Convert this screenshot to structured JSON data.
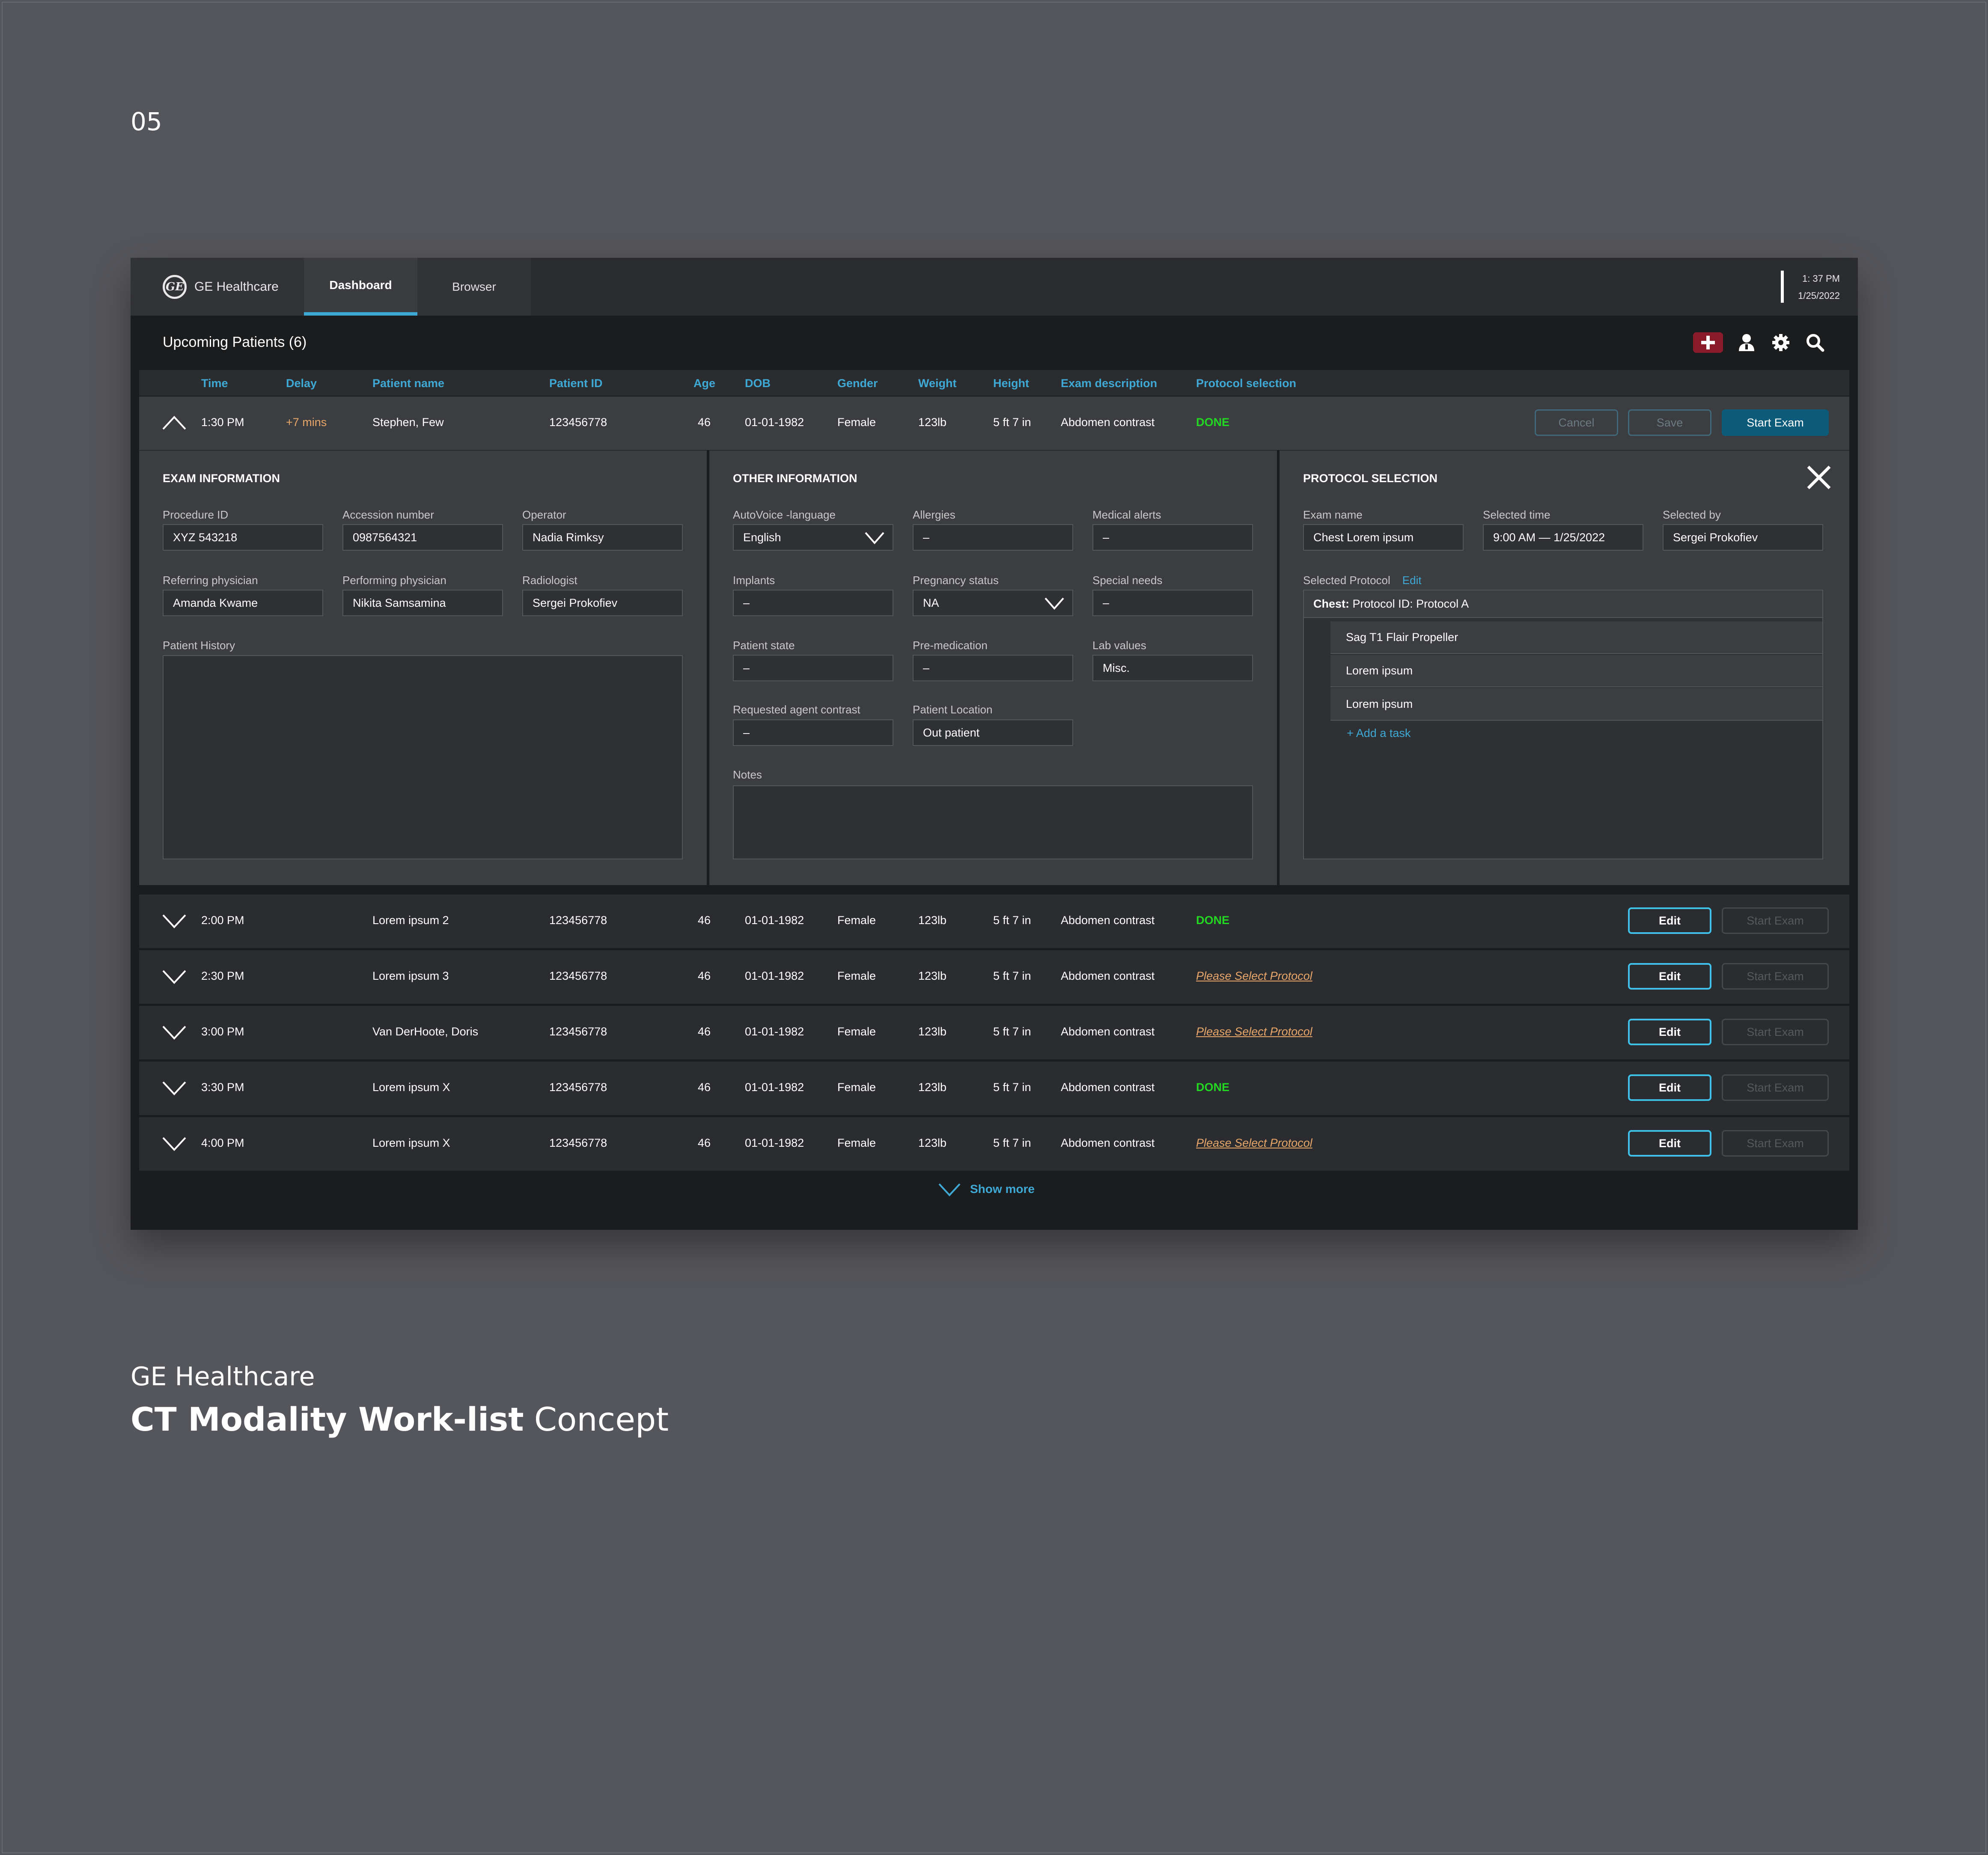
{
  "page_number": "05",
  "caption": {
    "company": "GE Healthcare",
    "title_bold": "CT Modality Work-list",
    "title_light": "Concept"
  },
  "topbar": {
    "brand": "GE Healthcare",
    "logo_text": "GE",
    "tabs": [
      "Dashboard",
      "Browser"
    ],
    "time": "1: 37 PM",
    "date": "1/25/2022"
  },
  "section_title": "Upcoming Patients (6)",
  "toolbar_icons": [
    "add-patient-icon",
    "user-icon",
    "gear-icon",
    "search-icon"
  ],
  "columns": [
    "Time",
    "Delay",
    "Patient name",
    "Patient ID",
    "Age",
    "DOB",
    "Gender",
    "Weight",
    "Height",
    "Exam description",
    "Protocol selection"
  ],
  "active_row": {
    "time": "1:30 PM",
    "delay": "+7 mins",
    "name": "Stephen, Few",
    "patient_id": "123456778",
    "age": "46",
    "dob": "01-01-1982",
    "gender": "Female",
    "weight": "123lb",
    "height": "5 ft 7 in",
    "exam": "Abdomen contrast",
    "protocol": "DONE",
    "buttons": {
      "cancel": "Cancel",
      "save": "Save",
      "start": "Start Exam"
    }
  },
  "exam_info": {
    "title": "EXAM INFORMATION",
    "procedure_id_label": "Procedure ID",
    "procedure_id": "XYZ 543218",
    "accession_label": "Accession number",
    "accession": "0987564321",
    "operator_label": "Operator",
    "operator": "Nadia Rimksy",
    "referring_label": "Referring physician",
    "referring": "Amanda Kwame",
    "performing_label": "Performing physician",
    "performing": "Nikita Samsamina",
    "radiologist_label": "Radiologist",
    "radiologist": "Sergei Prokofiev",
    "history_label": "Patient History"
  },
  "other_info": {
    "title": "OTHER INFORMATION",
    "autovoice_label": "AutoVoice -language",
    "autovoice": "English",
    "allergies_label": "Allergies",
    "allergies": "–",
    "medical_alerts_label": "Medical alerts",
    "medical_alerts": "–",
    "implants_label": "Implants",
    "implants": "–",
    "pregnancy_label": "Pregnancy status",
    "pregnancy": "NA",
    "special_needs_label": "Special needs",
    "special_needs": "–",
    "patient_state_label": "Patient state",
    "patient_state": "–",
    "premed_label": "Pre-medication",
    "premed": "–",
    "lab_label": "Lab values",
    "lab": "Misc.",
    "agent_label": "Requested agent contrast",
    "agent": "–",
    "location_label": "Patient Location",
    "location": "Out patient",
    "notes_label": "Notes"
  },
  "protocol": {
    "title": "PROTOCOL SELECTION",
    "exam_name_label": "Exam name",
    "exam_name": "Chest Lorem ipsum",
    "selected_time_label": "Selected time",
    "selected_time": "9:00 AM — 1/25/2022",
    "selected_by_label": "Selected by",
    "selected_by": "Sergei Prokofiev",
    "selected_protocol_label": "Selected Protocol",
    "edit": "Edit",
    "header_bold": "Chest:",
    "header_rest": " Protocol ID: Protocol A",
    "items": [
      "Sag T1 Flair Propeller",
      "Lorem ipsum",
      "Lorem ipsum"
    ],
    "add_task": "+ Add a task"
  },
  "rows": [
    {
      "time": "2:00 PM",
      "name": "Lorem ipsum 2",
      "patient_id": "123456778",
      "age": "46",
      "dob": "01-01-1982",
      "gender": "Female",
      "weight": "123lb",
      "height": "5 ft 7 in",
      "exam": "Abdomen contrast",
      "protocol": "DONE",
      "edit": "Edit",
      "start": "Start Exam"
    },
    {
      "time": "2:30 PM",
      "name": "Lorem ipsum 3",
      "patient_id": "123456778",
      "age": "46",
      "dob": "01-01-1982",
      "gender": "Female",
      "weight": "123lb",
      "height": "5 ft 7 in",
      "exam": "Abdomen contrast",
      "protocol": "Please Select Protocol",
      "edit": "Edit",
      "start": "Start Exam"
    },
    {
      "time": "3:00 PM",
      "name": "Van DerHoote, Doris",
      "patient_id": "123456778",
      "age": "46",
      "dob": "01-01-1982",
      "gender": "Female",
      "weight": "123lb",
      "height": "5 ft 7 in",
      "exam": "Abdomen contrast",
      "protocol": "Please Select Protocol",
      "edit": "Edit",
      "start": "Start Exam"
    },
    {
      "time": "3:30 PM",
      "name": "Lorem ipsum X",
      "patient_id": "123456778",
      "age": "46",
      "dob": "01-01-1982",
      "gender": "Female",
      "weight": "123lb",
      "height": "5 ft 7 in",
      "exam": "Abdomen contrast",
      "protocol": "DONE",
      "edit": "Edit",
      "start": "Start Exam"
    },
    {
      "time": "4:00 PM",
      "name": "Lorem ipsum X",
      "patient_id": "123456778",
      "age": "46",
      "dob": "01-01-1982",
      "gender": "Female",
      "weight": "123lb",
      "height": "5 ft 7 in",
      "exam": "Abdomen contrast",
      "protocol": "Please Select Protocol",
      "edit": "Edit",
      "start": "Start Exam"
    }
  ],
  "show_more": "Show more",
  "colors": {
    "accent": "#3fa9d6",
    "done": "#22d822",
    "warning": "#e8a76a",
    "alert": "#8c1b2a"
  }
}
